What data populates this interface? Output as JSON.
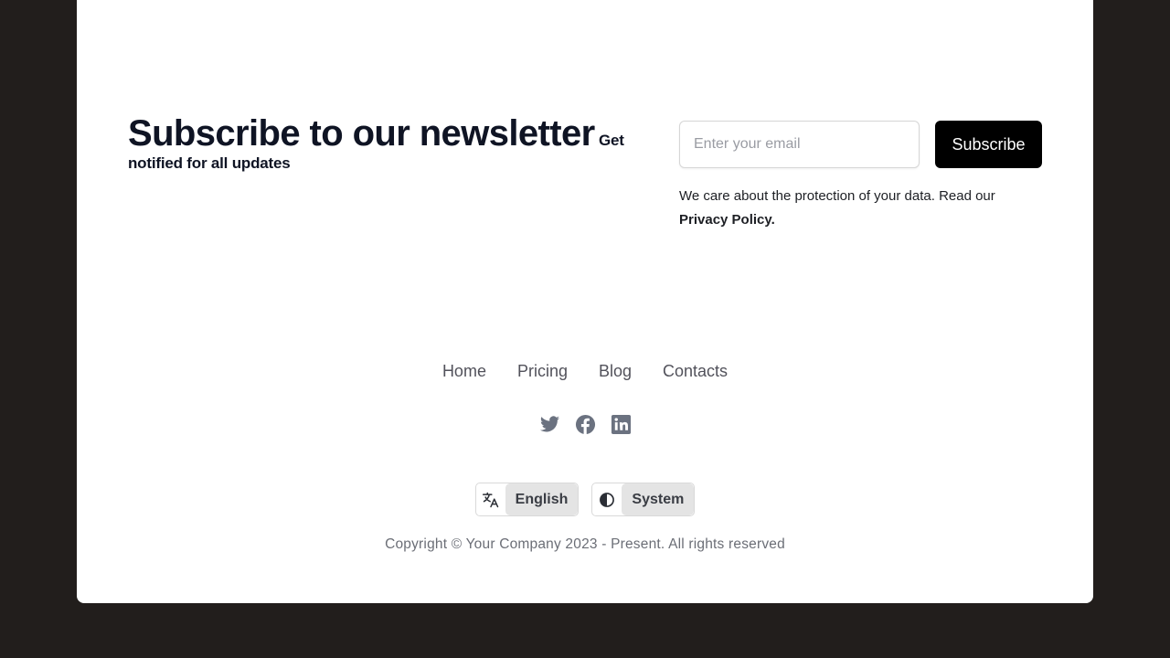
{
  "newsletter": {
    "title": "Subscribe to our newsletter",
    "subtitle": "Get notified for all updates",
    "email_placeholder": "Enter your email",
    "subscribe_label": "Subscribe",
    "privacy_text": "We care about the protection of your data. Read our",
    "privacy_link": "Privacy Policy."
  },
  "footer": {
    "nav": [
      "Home",
      "Pricing",
      "Blog",
      "Contacts"
    ],
    "social_icons": [
      "twitter-icon",
      "facebook-icon",
      "linkedin-icon"
    ],
    "language_icon": "translate-icon",
    "language_label": "English",
    "theme_icon": "contrast-icon",
    "theme_label": "System",
    "copyright": "Copyright © Your Company 2023 - Present. All rights reserved"
  },
  "colors": {
    "background": "#221e1c",
    "card": "#ffffff",
    "button": "#000000",
    "heading": "#0f1424",
    "icon": "#6b7280"
  }
}
